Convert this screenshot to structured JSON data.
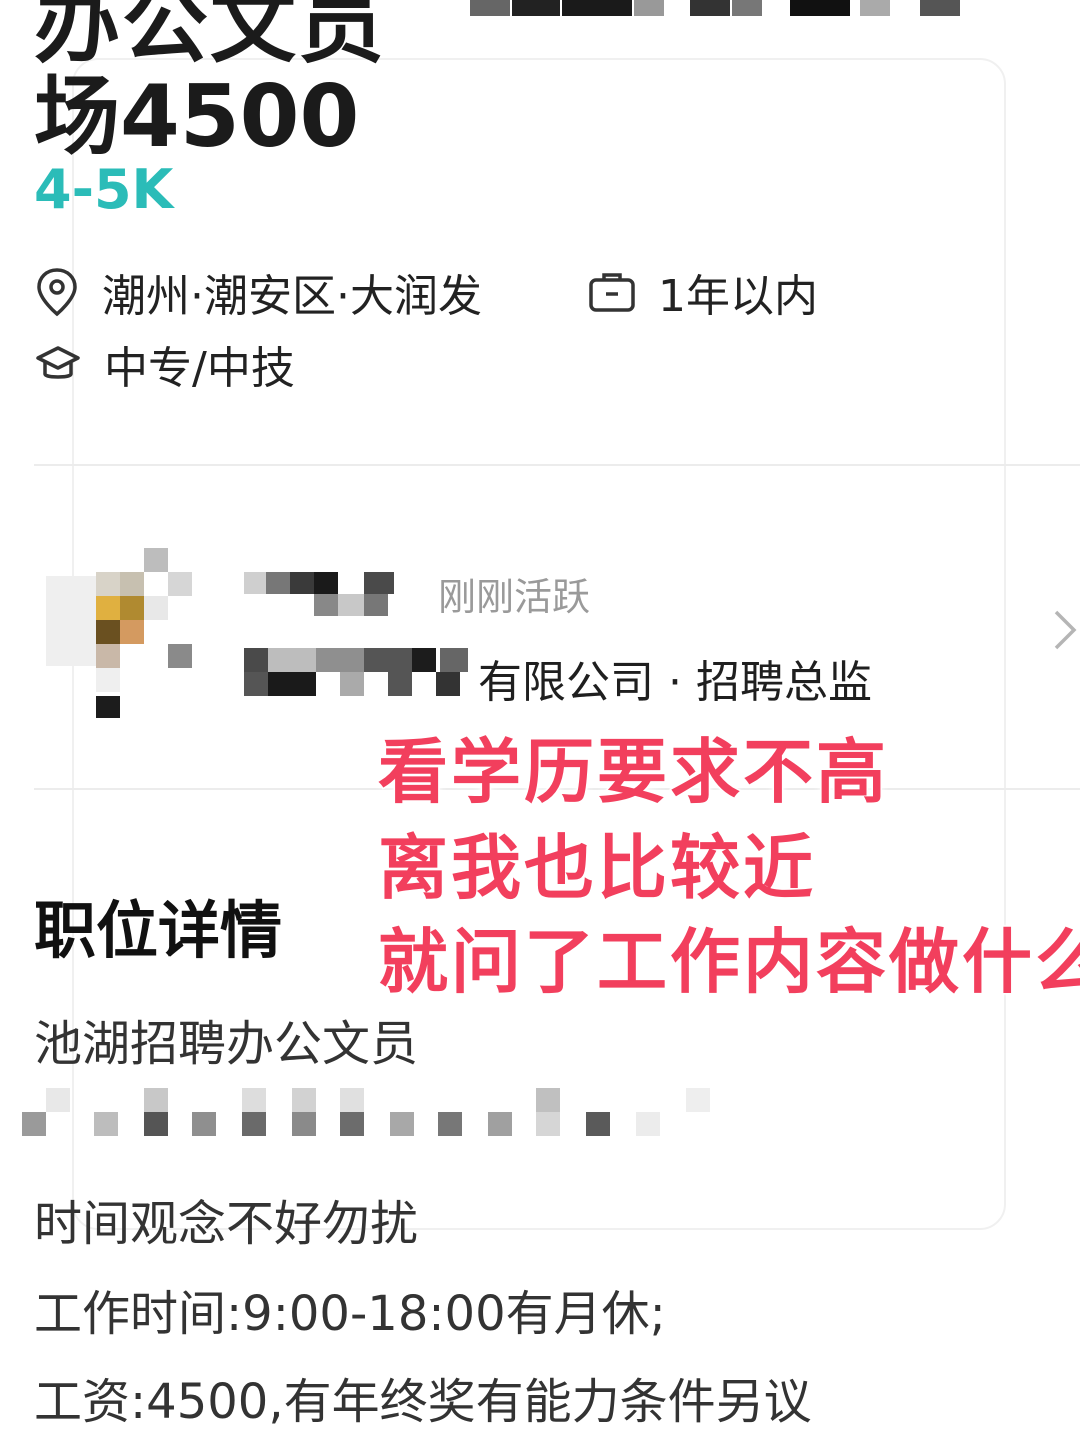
{
  "job": {
    "title_line1": "办公文员",
    "title_line2": "场4500",
    "salary": "4-5K",
    "location": "潮州·潮安区·大润发",
    "experience": "1年以内",
    "education": "中专/中技"
  },
  "recruiter": {
    "active_status": "刚刚活跃",
    "company_title": "有限公司 · 招聘总监"
  },
  "overlay": {
    "line1": "看学历要求不高",
    "line2": "离我也比较近",
    "line3": "就问了工作内容做什么"
  },
  "details": {
    "section_title": "职位详情",
    "line1": "池湖招聘办公文员",
    "line2": "时间观念不好勿扰",
    "line3": "工作时间:9:00-18:00有月休;",
    "line4": "工资:4500,有年终奖有能力条件另议"
  },
  "colors": {
    "salary": "#2bbcb8",
    "overlay_text": "#f23f5d"
  },
  "icons": {
    "location": "map-pin-icon",
    "experience": "briefcase-icon",
    "education": "graduation-cap-icon",
    "more": "chevron-right-icon"
  }
}
